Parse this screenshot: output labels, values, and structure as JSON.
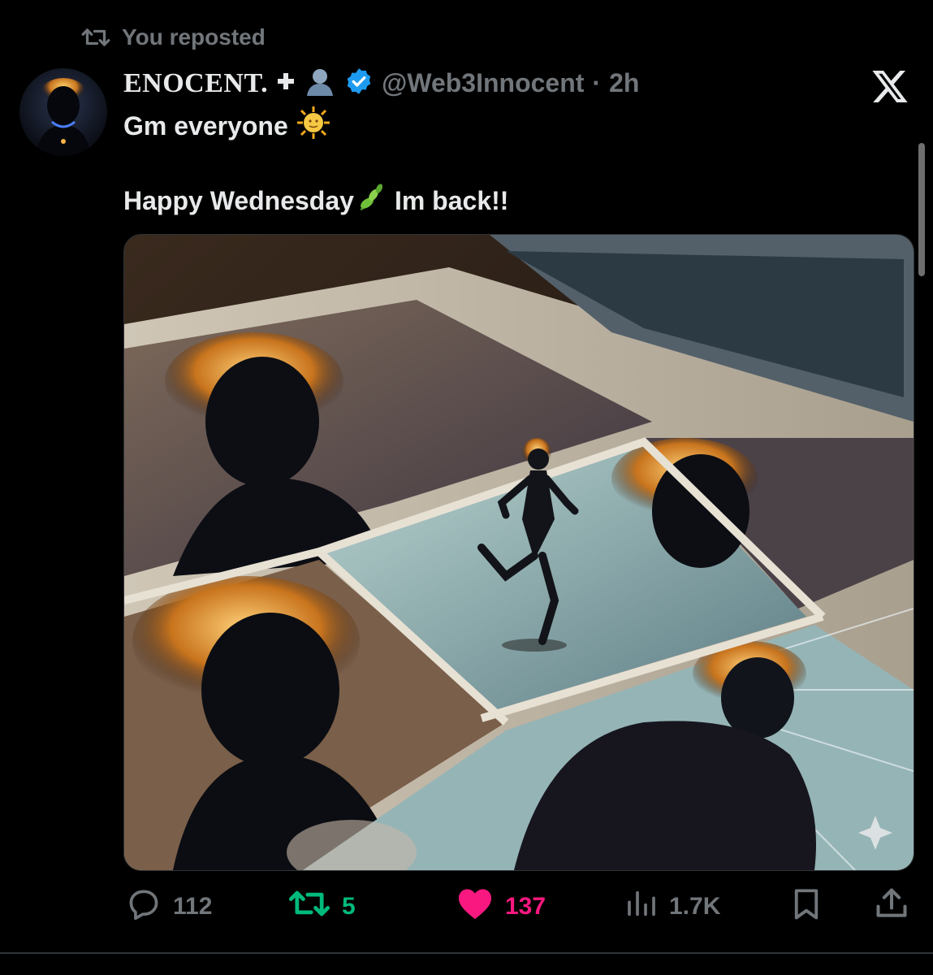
{
  "repost_banner": "You reposted",
  "author": {
    "display_name": "ENOCENT.",
    "name_suffix_emoji": "👤",
    "handle": "@Web3Innocent",
    "separator": "·",
    "time": "2h",
    "verified": true
  },
  "tweet": {
    "line1": "Gm everyone",
    "line1_emoji": "🌞",
    "line2_a": "Happy Wednesday",
    "line2_emoji": "🌿",
    "line2_b": "Im back!!"
  },
  "metrics": {
    "replies": "112",
    "reposts": "5",
    "likes": "137",
    "views": "1.7K"
  },
  "colors": {
    "background": "#000000",
    "text_primary": "#e7e9ea",
    "text_secondary": "#71767b",
    "repost_green": "#00ba7c",
    "like_pink": "#f91880",
    "verified_blue": "#1d9bf0"
  },
  "icons": {
    "repost": "repost-icon",
    "verified": "verified-badge-icon",
    "x_logo": "x-logo-icon",
    "reply": "reply-icon",
    "like": "heart-icon",
    "views": "views-icon",
    "bookmark": "bookmark-icon",
    "share": "share-icon",
    "ai_sparkle": "sparkle-icon"
  }
}
